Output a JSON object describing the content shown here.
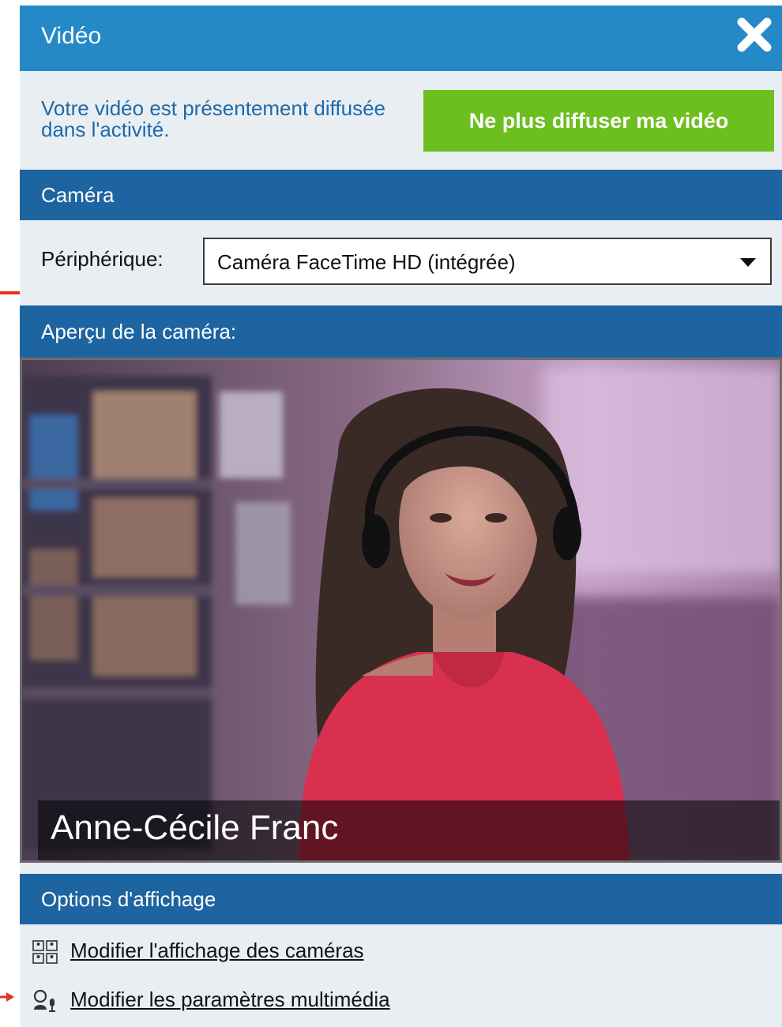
{
  "window": {
    "title": "Vidéo"
  },
  "broadcast": {
    "message": "Votre vidéo est présentement diffusée dans l'activité.",
    "stop_button_label": "Ne plus diffuser ma vidéo"
  },
  "camera_section": {
    "header": "Caméra",
    "device_label": "Périphérique:",
    "device_value": "Caméra FaceTime HD (intégrée)"
  },
  "preview_section": {
    "header": "Aperçu de la caméra:",
    "participant_name": "Anne-Cécile Franc"
  },
  "display_options": {
    "header": "Options d'affichage",
    "links": [
      {
        "label": "Modifier l'affichage des caméras",
        "icon": "camera-grid-icon"
      },
      {
        "label": "Modifier les paramètres multimédia",
        "icon": "user-mic-icon"
      }
    ]
  },
  "colors": {
    "title_bar": "#2489c6",
    "section_header": "#1e64a0",
    "panel_bg": "#e9eef3",
    "stop_button": "#6dbf1f",
    "message_text": "#1d6aa8",
    "annotation_arrow": "#e8321c"
  }
}
